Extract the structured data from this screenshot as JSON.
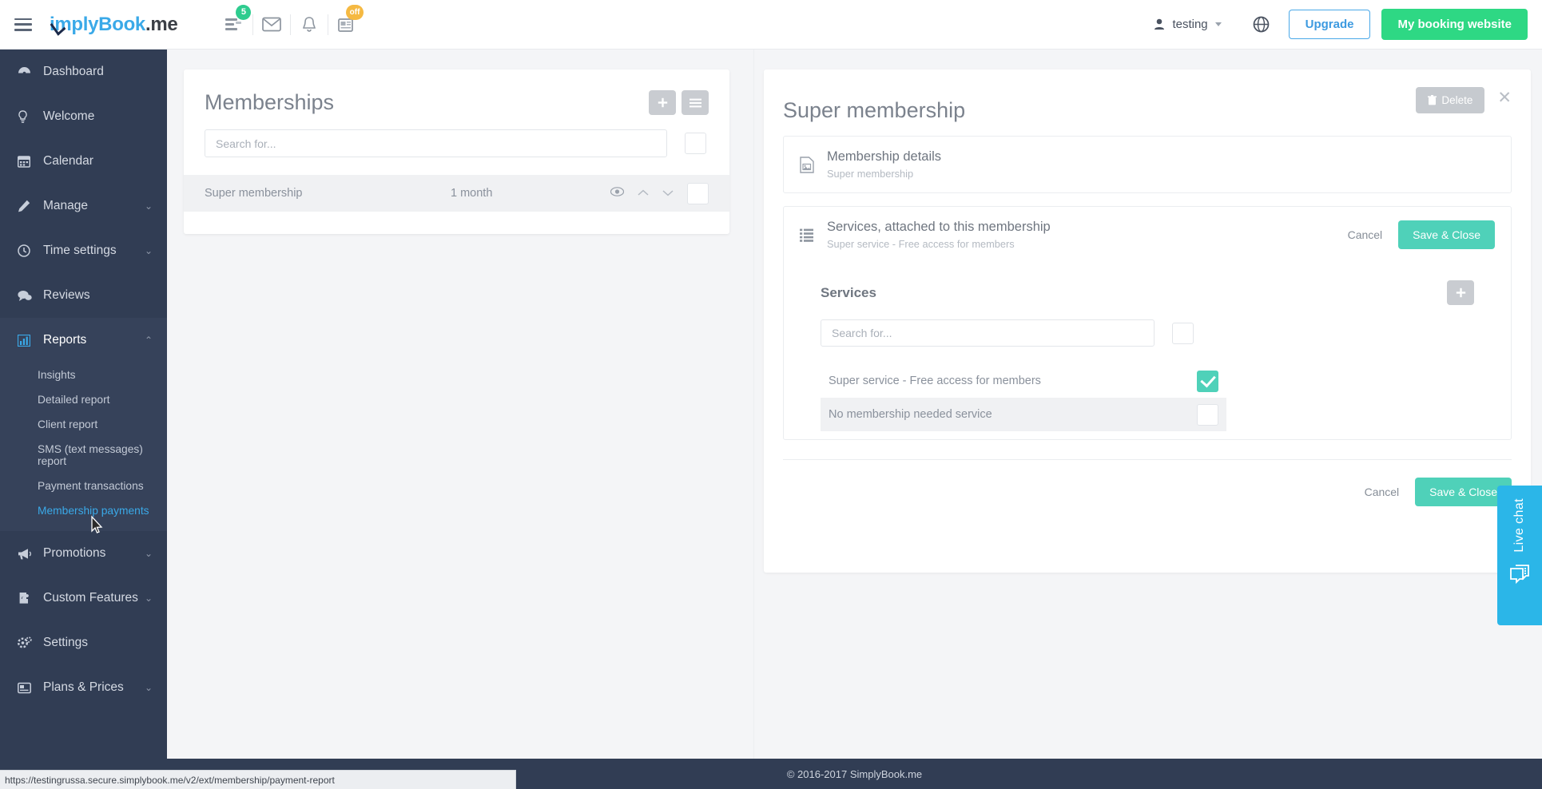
{
  "header": {
    "menu_icon": "hamburger-icon",
    "logo_primary": "implyBook",
    "logo_suffix": ".me",
    "icons": [
      {
        "name": "tasks-icon",
        "badge": "5",
        "badge_color": "#2ecc8f"
      },
      {
        "name": "mail-icon",
        "badge": ""
      },
      {
        "name": "bell-icon",
        "badge": ""
      },
      {
        "name": "news-icon",
        "badge": "off",
        "badge_color": "#f5b942"
      }
    ],
    "user_name": "testing",
    "globe_icon": "globe-icon",
    "upgrade_label": "Upgrade",
    "booking_website_label": "My booking website",
    "accent_green": "#2ed884",
    "accent_blue": "#3d9ae0"
  },
  "sidebar": {
    "items": [
      {
        "label": "Dashboard",
        "icon": "dashboard-icon",
        "expandable": false
      },
      {
        "label": "Welcome",
        "icon": "bulb-icon",
        "expandable": false
      },
      {
        "label": "Calendar",
        "icon": "calendar-icon",
        "expandable": false
      },
      {
        "label": "Manage",
        "icon": "pencil-icon",
        "expandable": true
      },
      {
        "label": "Time settings",
        "icon": "clock-icon",
        "expandable": true
      },
      {
        "label": "Reviews",
        "icon": "chat-icon",
        "expandable": false
      },
      {
        "label": "Reports",
        "icon": "chart-icon",
        "expandable": true,
        "expanded": true
      },
      {
        "label": "Promotions",
        "icon": "megaphone-icon",
        "expandable": true
      },
      {
        "label": "Custom Features",
        "icon": "puzzle-icon",
        "expandable": true
      },
      {
        "label": "Settings",
        "icon": "gears-icon",
        "expandable": false
      },
      {
        "label": "Plans & Prices",
        "icon": "card-icon",
        "expandable": true
      }
    ],
    "reports_sub": [
      {
        "label": "Insights",
        "active": false
      },
      {
        "label": "Detailed report",
        "active": false
      },
      {
        "label": "Client report",
        "active": false
      },
      {
        "label": "SMS (text messages) report",
        "active": false
      },
      {
        "label": "Payment transactions",
        "active": false
      },
      {
        "label": "Membership payments",
        "active": true
      }
    ]
  },
  "memberships_panel": {
    "title": "Memberships",
    "add_button_icon": "plus-icon",
    "list_button_icon": "list-icon",
    "search_placeholder": "Search for...",
    "select_all_checked": false,
    "rows": [
      {
        "name": "Super membership",
        "duration": "1 month",
        "eye_icon": "eye-icon",
        "up_icon": "chevron-up-icon",
        "down_icon": "chevron-down-icon",
        "checked": false
      }
    ]
  },
  "detail_panel": {
    "title": "Super membership",
    "delete_label": "Delete",
    "delete_icon": "trash-icon",
    "close_icon": "close-icon",
    "blocks": [
      {
        "icon": "image-file-icon",
        "title": "Membership details",
        "subtitle": "Super membership",
        "has_actions": false
      },
      {
        "icon": "list-lines-icon",
        "title": "Services, attached to this membership",
        "subtitle": "Super service - Free access for members",
        "has_actions": true,
        "cancel_label": "Cancel",
        "save_label": "Save & Close"
      }
    ],
    "services": {
      "title": "Services",
      "add_icon": "plus-icon",
      "search_placeholder": "Search for...",
      "select_all_checked": false,
      "rows": [
        {
          "label": "Super service - Free access for members",
          "checked": true
        },
        {
          "label": "No membership needed service",
          "checked": false
        }
      ]
    },
    "footer": {
      "cancel_label": "Cancel",
      "save_label": "Save & Close"
    },
    "accent_teal": "#4fd1b9"
  },
  "live_chat": {
    "label": "Live chat",
    "icon": "chat-bubble-icon",
    "color": "#2bb6e8"
  },
  "footer": {
    "copyright": "© 2016-2017 SimplyBook.me"
  },
  "status_bar": {
    "url": "https://testingrussa.secure.simplybook.me/v2/ext/membership/payment-report"
  }
}
